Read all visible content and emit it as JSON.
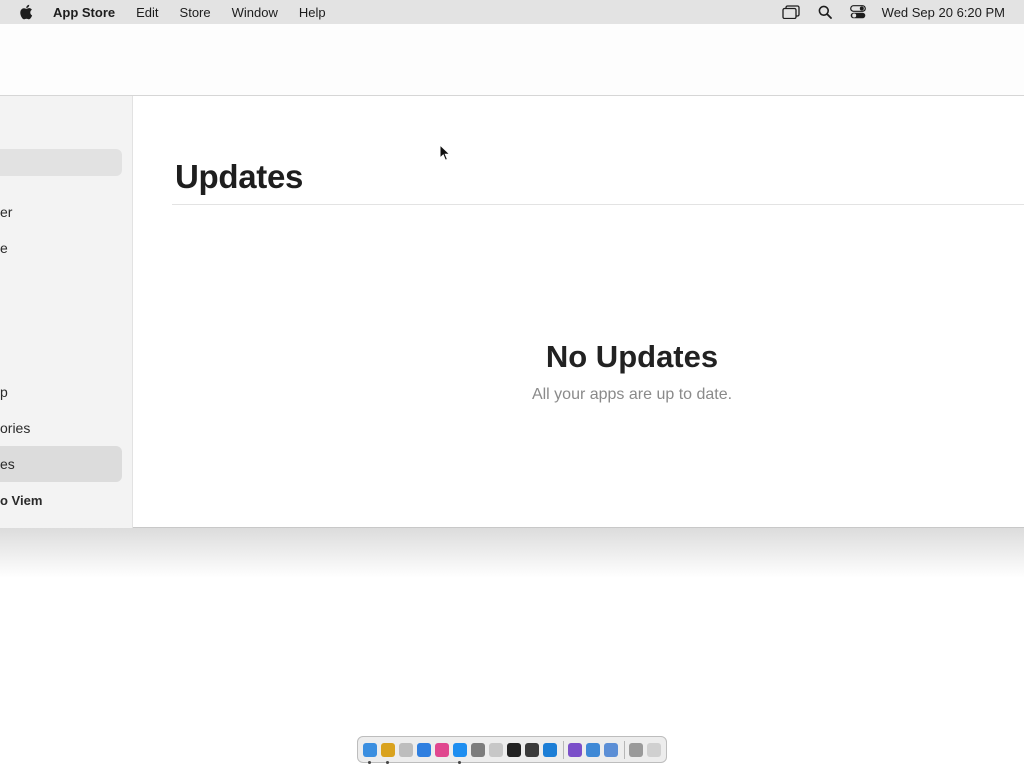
{
  "menubar": {
    "app_name": "App Store",
    "menus": [
      "Edit",
      "Store",
      "Window",
      "Help"
    ],
    "clock": "Wed Sep 20  6:20 PM",
    "icons": [
      "apple-icon",
      "window-icon",
      "search-icon",
      "control-center-icon"
    ]
  },
  "sidebar": {
    "items": [
      "er",
      "e",
      "p",
      "ories",
      "es"
    ],
    "user": "o Viem",
    "selected_index": 4
  },
  "main": {
    "title": "Updates",
    "empty_title": "No Updates",
    "empty_subtitle": "All your apps are up to date."
  },
  "dock": {
    "apps": [
      {
        "icon": "finder-icon",
        "color": "#3b8fe0"
      },
      {
        "icon": "chrome-icon",
        "color": "#d9a21e"
      },
      {
        "icon": "launchpad-icon",
        "color": "#bdbdbd"
      },
      {
        "icon": "safari-icon",
        "color": "#2f7fe0"
      },
      {
        "icon": "photos-app-icon",
        "color": "#e0478f"
      },
      {
        "icon": "app-store-icon",
        "color": "#1e8ef0"
      },
      {
        "icon": "system-settings-icon",
        "color": "#7d7d7d"
      },
      {
        "icon": "pencil-icon",
        "color": "#c7c7c7"
      },
      {
        "icon": "terminal-icon",
        "color": "#222222"
      },
      {
        "icon": "app-icon",
        "color": "#3a3a3a"
      },
      {
        "icon": "vscode-icon",
        "color": "#1c7ed6"
      },
      {
        "icon": "visual-studio-icon",
        "color": "#7b4fc9"
      },
      {
        "icon": "preview-icon",
        "color": "#3f89d6"
      },
      {
        "icon": "screen-sharing-icon",
        "color": "#5c8fd6"
      },
      {
        "icon": "keyboard-icon",
        "color": "#9a9a9a"
      },
      {
        "icon": "trash-icon",
        "color": "#d0d0d0"
      }
    ]
  }
}
